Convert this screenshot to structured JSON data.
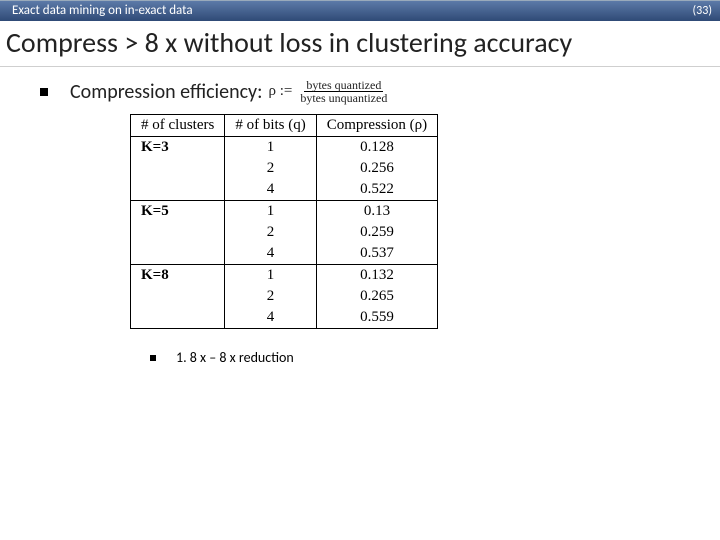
{
  "topbar": {
    "left": "Exact data mining on in-exact data",
    "right": "(33)"
  },
  "title": "Compress > 8 x without loss in clustering accuracy",
  "bullet1": {
    "label": "Compression efficiency:",
    "rho": "ρ :=",
    "num": "bytes quantized",
    "den": "bytes unquantized"
  },
  "table": {
    "headers": {
      "c1": "# of clusters",
      "c2": "# of bits (q)",
      "c3": "Compression (ρ)"
    },
    "groups": [
      {
        "k": "K=3",
        "rows": [
          {
            "q": "1",
            "rho": "0.128"
          },
          {
            "q": "2",
            "rho": "0.256"
          },
          {
            "q": "4",
            "rho": "0.522"
          }
        ]
      },
      {
        "k": "K=5",
        "rows": [
          {
            "q": "1",
            "rho": "0.13"
          },
          {
            "q": "2",
            "rho": "0.259"
          },
          {
            "q": "4",
            "rho": "0.537"
          }
        ]
      },
      {
        "k": "K=8",
        "rows": [
          {
            "q": "1",
            "rho": "0.132"
          },
          {
            "q": "2",
            "rho": "0.265"
          },
          {
            "q": "4",
            "rho": "0.559"
          }
        ]
      }
    ]
  },
  "sub_bullet": "1. 8 x – 8 x reduction",
  "chart_data": {
    "type": "table",
    "title": "Compression ratio ρ vs # of bits (q) for K clusters",
    "columns": [
      "# of clusters",
      "# of bits (q)",
      "Compression (ρ)"
    ],
    "rows": [
      [
        "K=3",
        1,
        0.128
      ],
      [
        "K=3",
        2,
        0.256
      ],
      [
        "K=3",
        4,
        0.522
      ],
      [
        "K=5",
        1,
        0.13
      ],
      [
        "K=5",
        2,
        0.259
      ],
      [
        "K=5",
        4,
        0.537
      ],
      [
        "K=8",
        1,
        0.132
      ],
      [
        "K=8",
        2,
        0.265
      ],
      [
        "K=8",
        4,
        0.559
      ]
    ]
  }
}
